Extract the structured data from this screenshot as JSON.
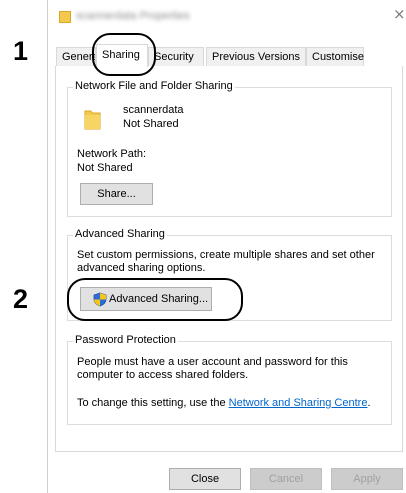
{
  "window": {
    "title": "scannerdata Properties",
    "close_glyph": "×"
  },
  "tabs": [
    {
      "label": "General"
    },
    {
      "label": "Sharing"
    },
    {
      "label": "Security"
    },
    {
      "label": "Previous Versions"
    },
    {
      "label": "Customise"
    }
  ],
  "network_sharing": {
    "legend": "Network File and Folder Sharing",
    "folder_name": "scannerdata",
    "status": "Not Shared",
    "path_label": "Network Path:",
    "path_value": "Not Shared",
    "share_button": "Share..."
  },
  "advanced_sharing": {
    "legend": "Advanced Sharing",
    "description_line1": "Set custom permissions, create multiple shares and set other",
    "description_line2": "advanced sharing options.",
    "button": "Advanced Sharing..."
  },
  "password_protection": {
    "legend": "Password Protection",
    "description_line1": "People must have a user account and password for this",
    "description_line2": "computer to access shared folders.",
    "change_prefix": "To change this setting, use the ",
    "link_text": "Network and Sharing Centre",
    "change_suffix": "."
  },
  "footer": {
    "close": "Close",
    "cancel": "Cancel",
    "apply": "Apply"
  },
  "callouts": {
    "step1": "1",
    "step2": "2"
  },
  "colors": {
    "link": "#0066cc",
    "folder": "#f2c94c",
    "shield_blue": "#2b6cd6",
    "shield_yellow": "#f5c518"
  }
}
